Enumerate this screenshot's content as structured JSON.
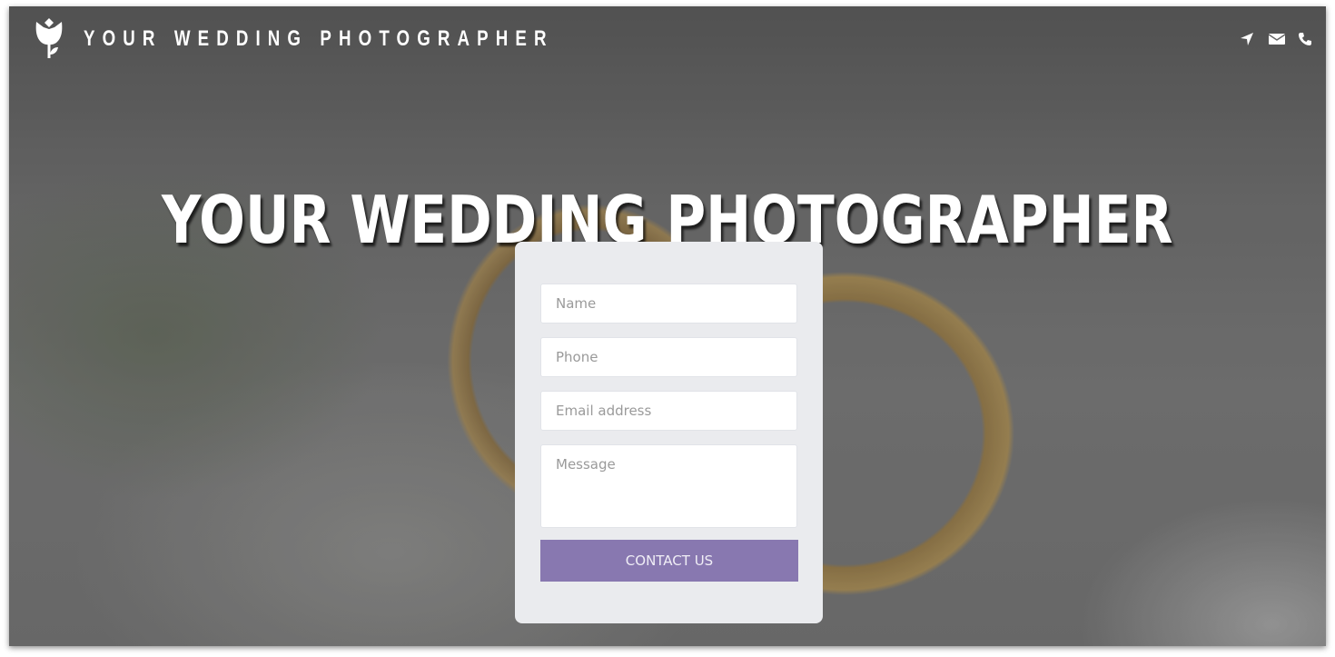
{
  "header": {
    "brand_icon": "tulip-icon",
    "brand_name": "YOUR WEDDING PHOTOGRAPHER",
    "contact_icons": [
      "location-arrow-icon",
      "envelope-icon",
      "phone-icon"
    ]
  },
  "hero": {
    "title": "YOUR WEDDING PHOTOGRAPHER",
    "background": "wedding-rings-photo"
  },
  "form": {
    "name_placeholder": "Name",
    "phone_placeholder": "Phone",
    "email_placeholder": "Email address",
    "message_placeholder": "Message",
    "submit_label": "CONTACT US"
  },
  "colors": {
    "accent": "#8878b0",
    "card": "#eaebee"
  }
}
